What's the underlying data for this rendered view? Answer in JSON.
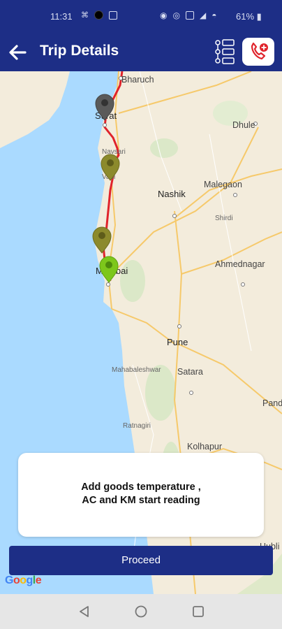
{
  "status_bar": {
    "time": "11:31",
    "battery": "61%",
    "left_icons": [
      "notification-icon",
      "circle-icon",
      "image-icon"
    ],
    "right_icons": [
      "location-icon",
      "hotspot-icon",
      "nfc-icon",
      "signal-icon",
      "wifi-icon",
      "battery-icon"
    ]
  },
  "app_bar": {
    "title": "Trip Details",
    "back_icon": "arrow-left-icon",
    "list_icon": "route-list-icon",
    "call_icon": "phone-add-icon"
  },
  "map": {
    "cities": [
      "Bharuch",
      "Surat",
      "Navsari",
      "Vapi",
      "Nashik",
      "Malegaon",
      "Dhule",
      "Shirdi",
      "Ahmednagar",
      "Mumbai",
      "Pune",
      "Mahabaleshwar",
      "Satara",
      "Ratnagiri",
      "Kolhapur",
      "Pand",
      "Hubli"
    ],
    "markers": [
      "grey",
      "olive",
      "olive",
      "green"
    ],
    "route_color": "#e0232b",
    "sea_color": "#aadaff",
    "attribution": "Google"
  },
  "card": {
    "line1": "Add goods temperature ,",
    "line2": "AC and KM start reading"
  },
  "proceed_label": "Proceed",
  "nav_bar": {
    "back": "triangle-back-icon",
    "home": "circle-home-icon",
    "recents": "square-recents-icon"
  },
  "colors": {
    "primary": "#1d2e86",
    "route": "#e0232b",
    "accent_red": "#e0232b"
  }
}
